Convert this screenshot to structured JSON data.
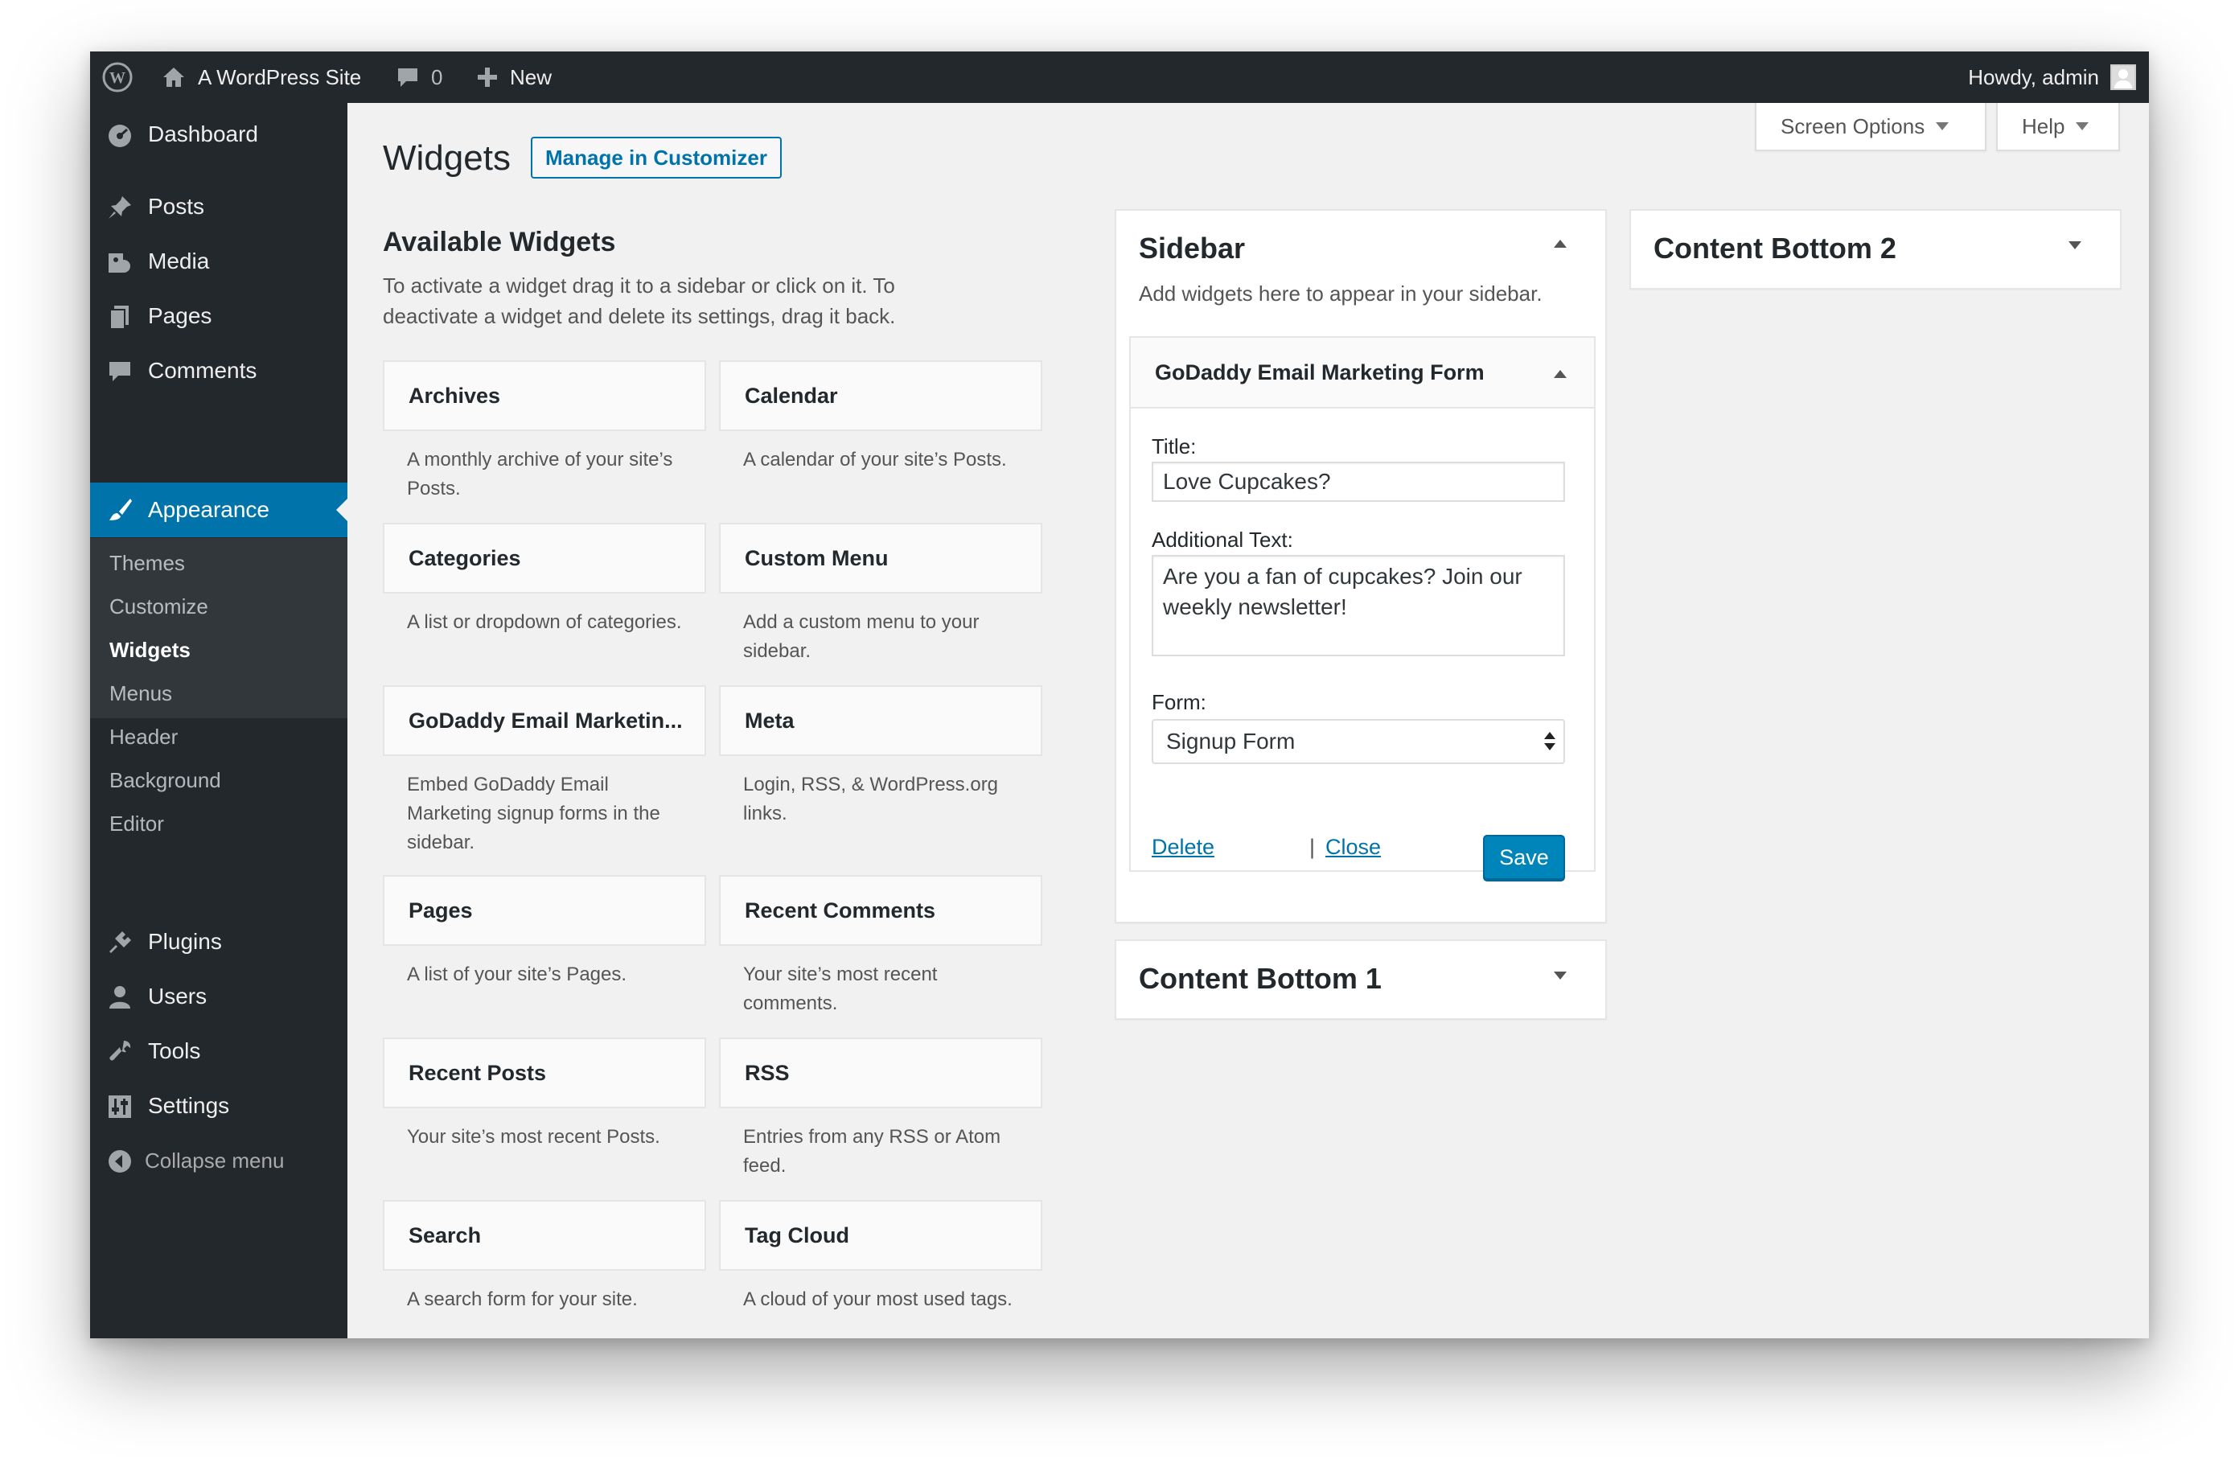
{
  "adminbar": {
    "site_name": "A WordPress Site",
    "comments_count": "0",
    "new_label": "New",
    "howdy": "Howdy, admin"
  },
  "menu": {
    "dashboard": "Dashboard",
    "posts": "Posts",
    "media": "Media",
    "pages": "Pages",
    "comments": "Comments",
    "appearance": "Appearance",
    "plugins": "Plugins",
    "users": "Users",
    "tools": "Tools",
    "settings": "Settings",
    "collapse": "Collapse menu",
    "submenu": [
      "Themes",
      "Customize",
      "Widgets",
      "Menus",
      "Header",
      "Background",
      "Editor"
    ],
    "current_submenu": "Widgets"
  },
  "page": {
    "title": "Widgets",
    "customizer_button": "Manage in Customizer",
    "screen_options": "Screen Options",
    "help": "Help"
  },
  "available": {
    "title": "Available Widgets",
    "description": "To activate a widget drag it to a sidebar or click on it. To deactivate a widget and delete its settings, drag it back.",
    "widgets": [
      {
        "name": "Archives",
        "desc": "A monthly archive of your site’s Posts."
      },
      {
        "name": "Calendar",
        "desc": "A calendar of your site’s Posts."
      },
      {
        "name": "Categories",
        "desc": "A list or dropdown of categories."
      },
      {
        "name": "Custom Menu",
        "desc": "Add a custom menu to your sidebar."
      },
      {
        "name": "GoDaddy Email Marketin...",
        "desc": "Embed GoDaddy Email Marketing signup forms in the sidebar."
      },
      {
        "name": "Meta",
        "desc": "Login, RSS, & WordPress.org links."
      },
      {
        "name": "Pages",
        "desc": "A list of your site’s Pages."
      },
      {
        "name": "Recent Comments",
        "desc": "Your site’s most recent comments."
      },
      {
        "name": "Recent Posts",
        "desc": "Your site’s most recent Posts."
      },
      {
        "name": "RSS",
        "desc": "Entries from any RSS or Atom feed."
      },
      {
        "name": "Search",
        "desc": "A search form for your site."
      },
      {
        "name": "Tag Cloud",
        "desc": "A cloud of your most used tags."
      }
    ]
  },
  "sidebar": {
    "title": "Sidebar",
    "description": "Add widgets here to appear in your sidebar.",
    "widget": {
      "title": "GoDaddy Email Marketing Form",
      "title_label": "Title:",
      "title_value": "Love Cupcakes?",
      "text_label": "Additional Text:",
      "text_value": "Are you a fan of cupcakes? Join our weekly newsletter!",
      "form_label": "Form:",
      "form_value": "Signup Form",
      "delete": "Delete",
      "separator": "|",
      "close": "Close",
      "save": "Save"
    }
  },
  "content_bottom_1": {
    "title": "Content Bottom 1"
  },
  "content_bottom_2": {
    "title": "Content Bottom 2"
  }
}
